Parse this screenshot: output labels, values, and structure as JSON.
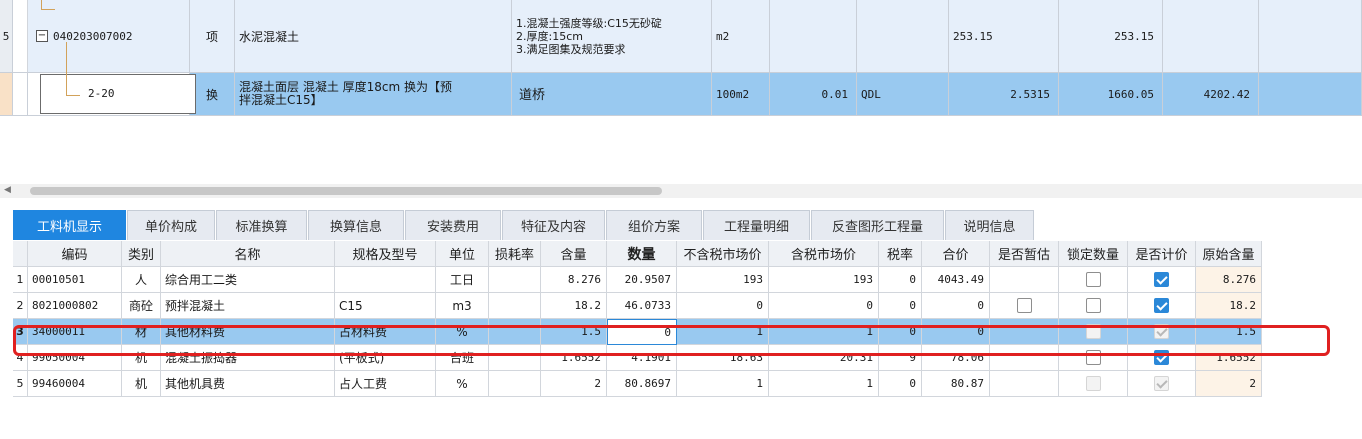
{
  "upper_table": {
    "row1": {
      "rownum": "5",
      "expand": "−",
      "code": "040203007002",
      "type": "项",
      "name": "水泥混凝土",
      "desc_lines": [
        "1.混凝土强度等级:C15无砂碇",
        "2.厚度:15cm",
        "3.满足图集及规范要求"
      ],
      "unit": "m2",
      "qty1": "253.15",
      "qty2": "253.15"
    },
    "row2": {
      "code": "2-20",
      "type": "换",
      "name_line1": "混凝土面层 混凝土 厚度18cm  换为【预",
      "name_line2": "拌混凝土C15】",
      "specialty": "道桥",
      "unit": "100m2",
      "ratio": "0.01",
      "expr": "QDL",
      "qty": "2.5315",
      "price": "1660.05",
      "total": "4202.42"
    }
  },
  "tabs": [
    "工料机显示",
    "单价构成",
    "标准换算",
    "换算信息",
    "安装费用",
    "特征及内容",
    "组价方案",
    "工程量明细",
    "反查图形工程量",
    "说明信息"
  ],
  "active_tab": "工料机显示",
  "grid": {
    "headers": [
      "编码",
      "类别",
      "名称",
      "规格及型号",
      "单位",
      "损耗率",
      "含量",
      "数量",
      "不含税市场价",
      "含税市场价",
      "税率",
      "合价",
      "是否暂估",
      "锁定数量",
      "是否计价",
      "原始含量"
    ],
    "rows": [
      {
        "n": "1",
        "code": "00010501",
        "cat": "人",
        "name": "综合用工二类",
        "spec": "",
        "unit": "工日",
        "loss": "",
        "content": "8.276",
        "qty": "20.9507",
        "price_ex": "193",
        "price_in": "193",
        "tax": "0",
        "total": "4043.49",
        "provisional": "none",
        "lock": "off",
        "priced": "on",
        "orig": "8.276"
      },
      {
        "n": "2",
        "code": "8021000802",
        "cat": "商砼",
        "name": "预拌混凝土",
        "spec": "C15",
        "unit": "m3",
        "loss": "",
        "content": "18.2",
        "qty": "46.0733",
        "price_ex": "0",
        "price_in": "0",
        "tax": "0",
        "total": "0",
        "provisional": "off",
        "lock": "off",
        "priced": "on",
        "orig": "18.2"
      },
      {
        "n": "3",
        "code": "34000011",
        "cat": "材",
        "name": "其他材料费",
        "spec": "占材料费",
        "unit": "%",
        "loss": "",
        "content": "1.5",
        "qty": "0",
        "price_ex": "1",
        "price_in": "1",
        "tax": "0",
        "total": "0",
        "provisional": "none",
        "lock": "dis",
        "priced": "dison",
        "orig": "1.5"
      },
      {
        "n": "4",
        "code": "99050004",
        "cat": "机",
        "name": "混凝土振捣器",
        "spec": "(平板式)",
        "unit": "台班",
        "loss": "",
        "content": "1.6552",
        "qty": "4.1901",
        "price_ex": "18.63",
        "price_in": "20.31",
        "tax": "9",
        "total": "78.06",
        "provisional": "none",
        "lock": "off",
        "priced": "on",
        "orig": "1.6552"
      },
      {
        "n": "5",
        "code": "99460004",
        "cat": "机",
        "name": "其他机具费",
        "spec": "占人工费",
        "unit": "%",
        "loss": "",
        "content": "2",
        "qty": "80.8697",
        "price_ex": "1",
        "price_in": "1",
        "tax": "0",
        "total": "80.87",
        "provisional": "none",
        "lock": "dis",
        "priced": "dison",
        "orig": "2"
      }
    ]
  }
}
